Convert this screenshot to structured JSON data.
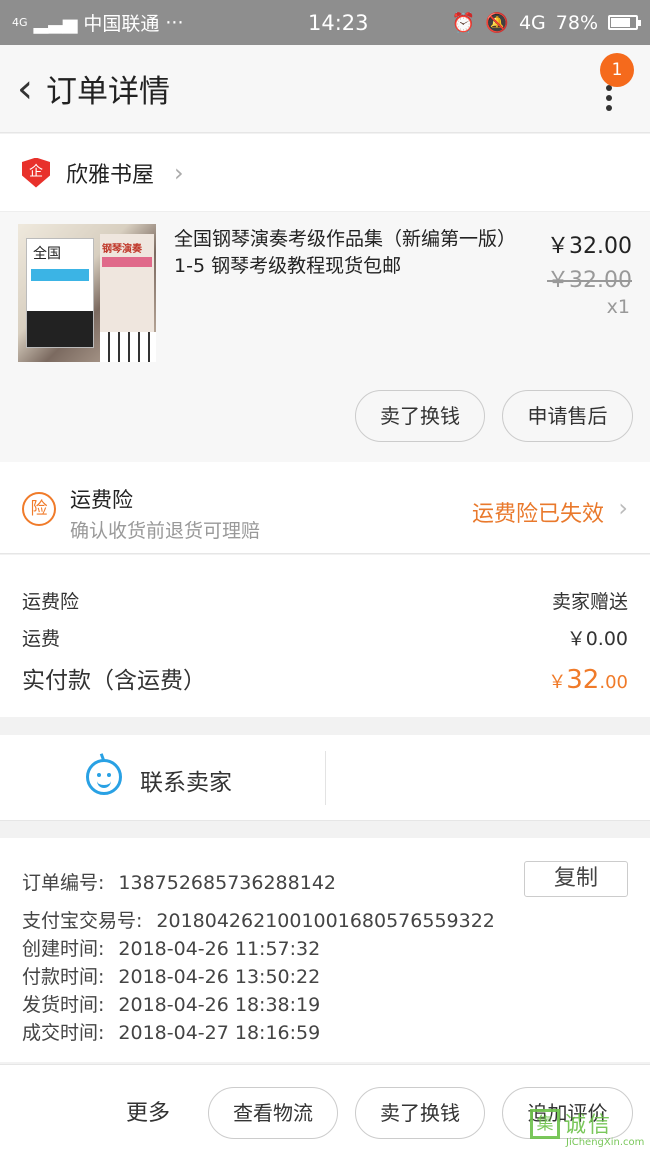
{
  "status_bar": {
    "network": "4G",
    "carrier": "中国联通",
    "more": "···",
    "time": "14:23",
    "net_type": "4G",
    "battery": "78%",
    "battery_level": 0.78
  },
  "nav": {
    "back_icon": "‹",
    "title": "订单详情",
    "badge_count": "1"
  },
  "shop": {
    "badge_text": "企",
    "name": "欣雅书屋",
    "chevron": "›"
  },
  "item": {
    "cover_title": "全国",
    "cover_b_title": "钢琴演奏",
    "title": "全国钢琴演奏考级作品集（新编第一版）1-5 钢琴考级教程现货包邮",
    "price": "￥32.00",
    "original_price": "￥32.00",
    "quantity": "x1",
    "buttons": [
      "卖了换钱",
      "申请售后"
    ]
  },
  "insurance": {
    "icon_text": "险",
    "title": "运费险",
    "subtitle": "确认收货前退货可理赔",
    "status": "运费险已失效",
    "chevron": "›"
  },
  "fees": {
    "rows": [
      {
        "label": "运费险",
        "value": "卖家赠送"
      },
      {
        "label": "运费",
        "value": "￥0.00"
      }
    ],
    "total_label": "实付款（含运费）",
    "total_currency": "￥",
    "total_int": "32",
    "total_dec": ".00"
  },
  "contact": {
    "label": "联系卖家"
  },
  "order": {
    "copy_label": "复制",
    "rows": [
      {
        "label": "订单编号:",
        "value": "138752685736288142"
      },
      {
        "label": "支付宝交易号:",
        "value": "2018042621001001680576559322"
      },
      {
        "label": "创建时间:",
        "value": "2018-04-26 11:57:32"
      },
      {
        "label": "付款时间:",
        "value": "2018-04-26 13:50:22"
      },
      {
        "label": "发货时间:",
        "value": "2018-04-26 18:38:19"
      },
      {
        "label": "成交时间:",
        "value": "2018-04-27 18:16:59"
      }
    ]
  },
  "bottom": {
    "more_label": "更多",
    "buttons": [
      "查看物流",
      "卖了换钱",
      "追加评价"
    ]
  },
  "watermark": {
    "box": "集",
    "text": "诚信",
    "sub": "JiChengXin.com"
  },
  "colors": {
    "accent_orange": "#f07b2a",
    "badge_orange": "#f56a1c",
    "contact_blue": "#29a1e4",
    "shop_red": "#e8312b"
  }
}
